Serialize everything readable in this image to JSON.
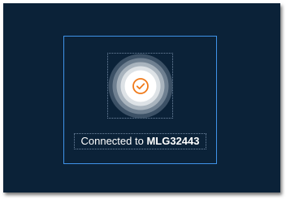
{
  "status": {
    "prefix": "Connected to ",
    "device_name": "MLG32443"
  },
  "icon": {
    "name": "check-circle-icon",
    "color": "#f07a1a"
  },
  "colors": {
    "background": "#0b2238",
    "selection_border": "#3f93e8",
    "text": "#ffffff"
  }
}
